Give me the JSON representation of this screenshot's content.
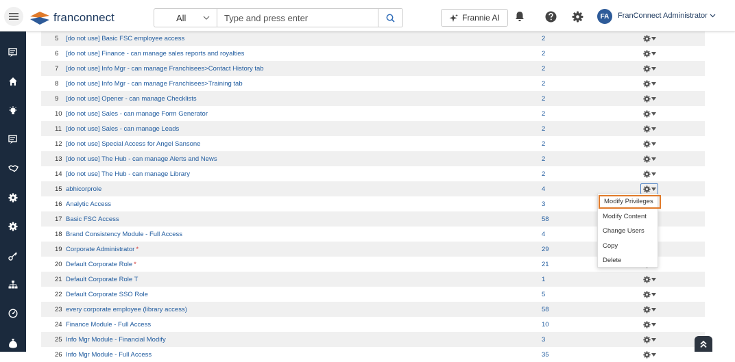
{
  "header": {
    "logo_text": "franconnect",
    "search_scope": "All",
    "search_placeholder": "Type and press enter",
    "frannie_label": "Frannie AI",
    "avatar_initials": "FA",
    "user_name": "FranConnect Administrator"
  },
  "colors": {
    "sidebar": "#1b2a3d",
    "link": "#1e5a9e",
    "highlight": "#e07a2a",
    "avatar": "#2e5b99"
  },
  "roles": [
    {
      "num": "5",
      "name": "[do not use] Basic FSC employee access",
      "users": "2",
      "star": ""
    },
    {
      "num": "6",
      "name": "[do not use] Finance - can manage sales reports and royalties",
      "users": "2",
      "star": ""
    },
    {
      "num": "7",
      "name": "[do not use] Info Mgr - can manage Franchisees>Contact History tab",
      "users": "2",
      "star": ""
    },
    {
      "num": "8",
      "name": "[do not use] Info Mgr - can manage Franchisees>Training tab",
      "users": "2",
      "star": ""
    },
    {
      "num": "9",
      "name": "[do not use] Opener - can manage Checklists",
      "users": "2",
      "star": ""
    },
    {
      "num": "10",
      "name": "[do not use] Sales - can manage Form Generator",
      "users": "2",
      "star": ""
    },
    {
      "num": "11",
      "name": "[do not use] Sales - can manage Leads",
      "users": "2",
      "star": ""
    },
    {
      "num": "12",
      "name": "[do not use] Special Access for Angel Sansone",
      "users": "2",
      "star": ""
    },
    {
      "num": "13",
      "name": "[do not use] The Hub - can manage Alerts and News",
      "users": "2",
      "star": ""
    },
    {
      "num": "14",
      "name": "[do not use] The Hub - can manage Library",
      "users": "2",
      "star": ""
    },
    {
      "num": "15",
      "name": "abhicorprole",
      "users": "4",
      "star": ""
    },
    {
      "num": "16",
      "name": "Analytic Access",
      "users": "3",
      "star": ""
    },
    {
      "num": "17",
      "name": "Basic FSC Access",
      "users": "58",
      "star": ""
    },
    {
      "num": "18",
      "name": "Brand Consistency Module - Full Access",
      "users": "4",
      "star": ""
    },
    {
      "num": "19",
      "name": "Corporate Administrator",
      "users": "29",
      "star": "*"
    },
    {
      "num": "20",
      "name": "Default Corporate Role",
      "users": "21",
      "star": "*"
    },
    {
      "num": "21",
      "name": "Default Corporate Role T",
      "users": "1",
      "star": ""
    },
    {
      "num": "22",
      "name": "Default Corporate SSO Role",
      "users": "5",
      "star": ""
    },
    {
      "num": "23",
      "name": "every corporate employee (library access)",
      "users": "58",
      "star": ""
    },
    {
      "num": "24",
      "name": "Finance Module - Full Access",
      "users": "10",
      "star": ""
    },
    {
      "num": "25",
      "name": "Info Mgr Module - Financial Modify",
      "users": "3",
      "star": ""
    },
    {
      "num": "26",
      "name": "Info Mgr Module - Full Access",
      "users": "35",
      "star": ""
    }
  ],
  "action_menu": {
    "items": [
      "Modify Privileges",
      "Modify Content",
      "Change Users",
      "Copy",
      "Delete"
    ],
    "open_for_row": "15",
    "highlighted_item": "Modify Privileges"
  }
}
